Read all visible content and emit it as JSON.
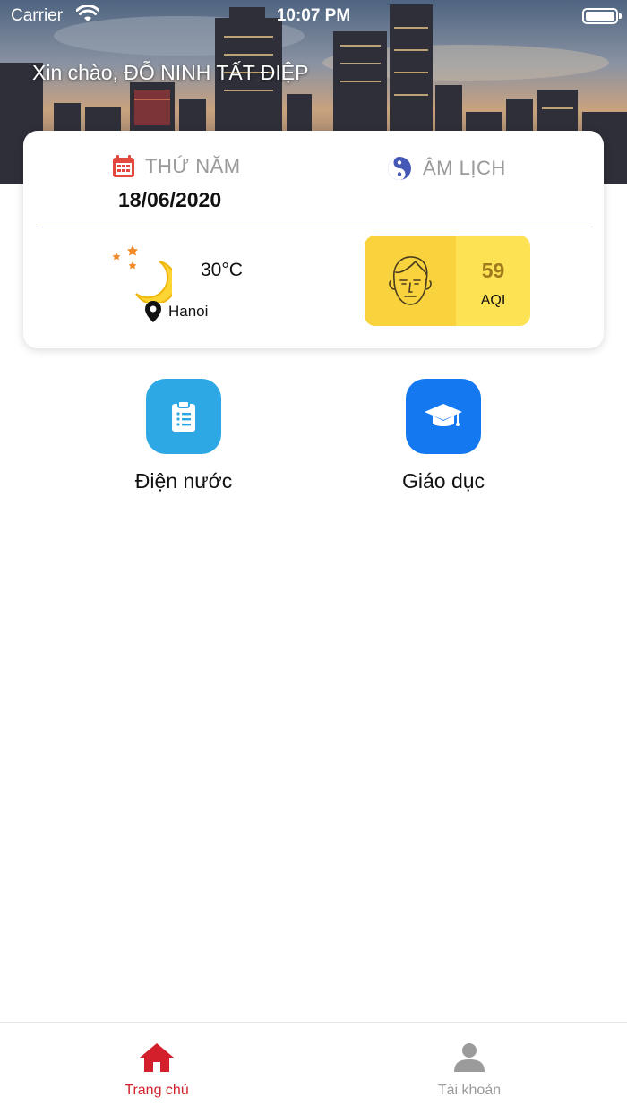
{
  "status_bar": {
    "carrier": "Carrier",
    "time": "10:07 PM"
  },
  "header": {
    "greeting": "Xin chào, ĐỖ NINH TẤT ĐIỆP"
  },
  "card": {
    "day_name": "THỨ NĂM",
    "date": "18/06/2020",
    "lunar_label": "ÂM LỊCH",
    "temperature": "30°C",
    "location": "Hanoi",
    "aqi_value": "59",
    "aqi_label": "AQI"
  },
  "services": [
    {
      "label": "Điện nước",
      "icon": "clipboard-icon",
      "color": "#2ea8e4"
    },
    {
      "label": "Giáo dục",
      "icon": "graduation-cap-icon",
      "color": "#1479f0"
    }
  ],
  "tabs": [
    {
      "label": "Trang chủ",
      "icon": "home-icon",
      "active": true,
      "color": "#d21f2b"
    },
    {
      "label": "Tài khoản",
      "icon": "user-icon",
      "active": false,
      "color": "#9b9b9b"
    }
  ],
  "colors": {
    "calendar_icon": "#e3483f",
    "yin_yang_icon": "#4558b5",
    "aqi_bg": "#fde253",
    "aqi_value": "#a07a1c"
  }
}
